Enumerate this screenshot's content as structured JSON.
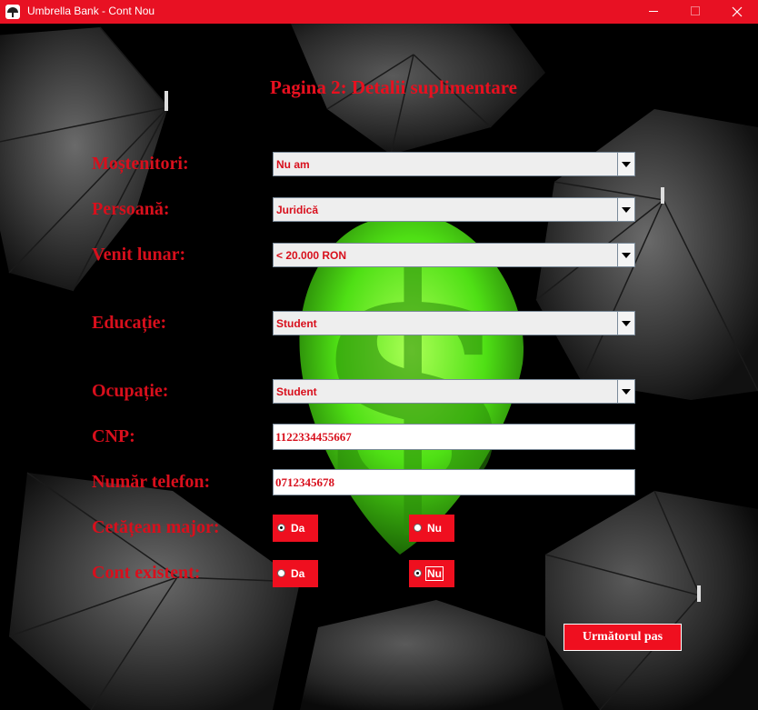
{
  "window": {
    "title": "Umbrella Bank - Cont Nou"
  },
  "page": {
    "title": "Pagina 2: Detalii suplimentare"
  },
  "fields": {
    "mostenitori": {
      "label": "Moștenitori:",
      "value": "Nu am"
    },
    "persoana": {
      "label": "Persoană:",
      "value": "Juridică"
    },
    "venit": {
      "label": "Venit lunar:",
      "value": "< 20.000 RON"
    },
    "educatie": {
      "label": "Educație:",
      "value": "Student"
    },
    "ocupatie": {
      "label": "Ocupație:",
      "value": "Student"
    },
    "cnp": {
      "label": "CNP:",
      "value": "1122334455667"
    },
    "telefon": {
      "label": "Număr telefon:",
      "value": "0712345678"
    },
    "cetatean": {
      "label": "Cetățean major:",
      "yes": "Da",
      "no": "Nu",
      "selected": "Da"
    },
    "cont": {
      "label": "Cont existent:",
      "yes": "Da",
      "no": "Nu",
      "selected": "Nu"
    }
  },
  "actions": {
    "next_label": "Următorul pas"
  },
  "colors": {
    "accent": "#e81123",
    "text_red": "#d80f1c",
    "dollar_green": "#55ee22"
  },
  "icons": {
    "app": "umbrella-icon",
    "minimize": "minimize-icon",
    "maximize": "maximize-icon",
    "close": "close-icon",
    "dropdown": "chevron-down-icon"
  }
}
